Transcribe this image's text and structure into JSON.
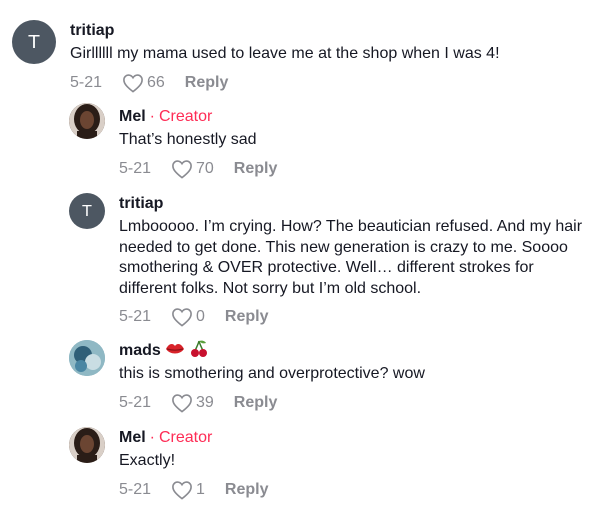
{
  "comments": [
    {
      "username": "tritiap",
      "avatar_letter": "T",
      "text": "Girllllll my mama used to leave me at the shop when I was 4!",
      "date": "5-21",
      "likes": "66",
      "reply_label": "Reply"
    },
    {
      "username": "Mel",
      "separator": "·",
      "badge": "Creator",
      "text": "That’s honestly sad",
      "date": "5-21",
      "likes": "70",
      "reply_label": "Reply"
    },
    {
      "username": "tritiap",
      "avatar_letter": "T",
      "text": "Lmbooooo. I’m crying. How? The beautician refused. And my hair needed to get done. This new generation is crazy to me. Soooo smothering & OVER protective. Well… different strokes for different folks. Not sorry but I’m old school.",
      "date": "5-21",
      "likes": "0",
      "reply_label": "Reply"
    },
    {
      "username": "mads",
      "emojis": [
        "lips-emoji",
        "cherries-emoji"
      ],
      "text": "this is smothering and overprotective? wow",
      "date": "5-21",
      "likes": "39",
      "reply_label": "Reply"
    },
    {
      "username": "Mel",
      "separator": "·",
      "badge": "Creator",
      "text": "Exactly!",
      "date": "5-21",
      "likes": "1",
      "reply_label": "Reply"
    }
  ],
  "colors": {
    "accent": "#fe2c55",
    "muted": "#8a8b91",
    "avatar_bg": "#4d5762"
  }
}
